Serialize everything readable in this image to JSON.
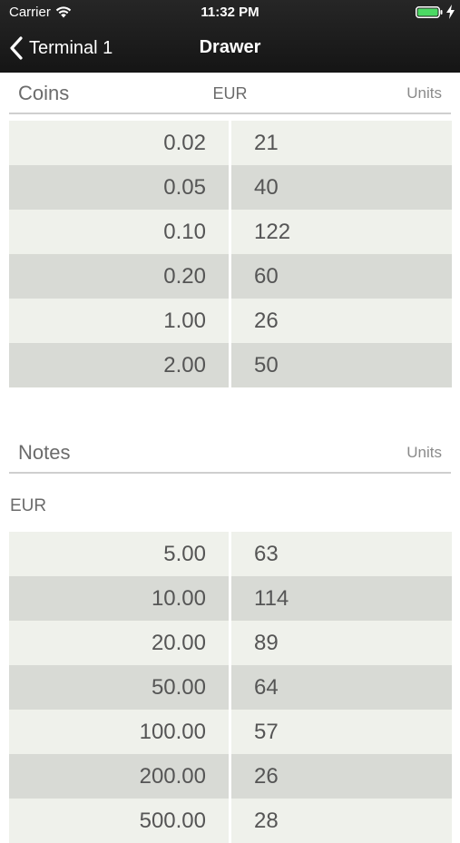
{
  "status_bar": {
    "carrier": "Carrier",
    "time": "11:32 PM",
    "battery_color": "#4cd964"
  },
  "nav": {
    "back_label": "Terminal 1",
    "title": "Drawer",
    "back_icon": "chevron-left-icon"
  },
  "coins": {
    "title": "Coins",
    "currency": "EUR",
    "units_label": "Units",
    "rows": [
      {
        "value": "0.02",
        "units": "21"
      },
      {
        "value": "0.05",
        "units": "40"
      },
      {
        "value": "0.10",
        "units": "122"
      },
      {
        "value": "0.20",
        "units": "60"
      },
      {
        "value": "1.00",
        "units": "26"
      },
      {
        "value": "2.00",
        "units": "50"
      }
    ]
  },
  "notes": {
    "title": "Notes",
    "units_label": "Units",
    "currency": "EUR",
    "rows": [
      {
        "value": "5.00",
        "units": "63"
      },
      {
        "value": "10.00",
        "units": "114"
      },
      {
        "value": "20.00",
        "units": "89"
      },
      {
        "value": "50.00",
        "units": "64"
      },
      {
        "value": "100.00",
        "units": "57"
      },
      {
        "value": "200.00",
        "units": "26"
      },
      {
        "value": "500.00",
        "units": "28"
      }
    ]
  },
  "colors": {
    "row_light": "#eff1eb",
    "row_dark": "#d8dad5",
    "nav_background": "#1c1c1c"
  }
}
